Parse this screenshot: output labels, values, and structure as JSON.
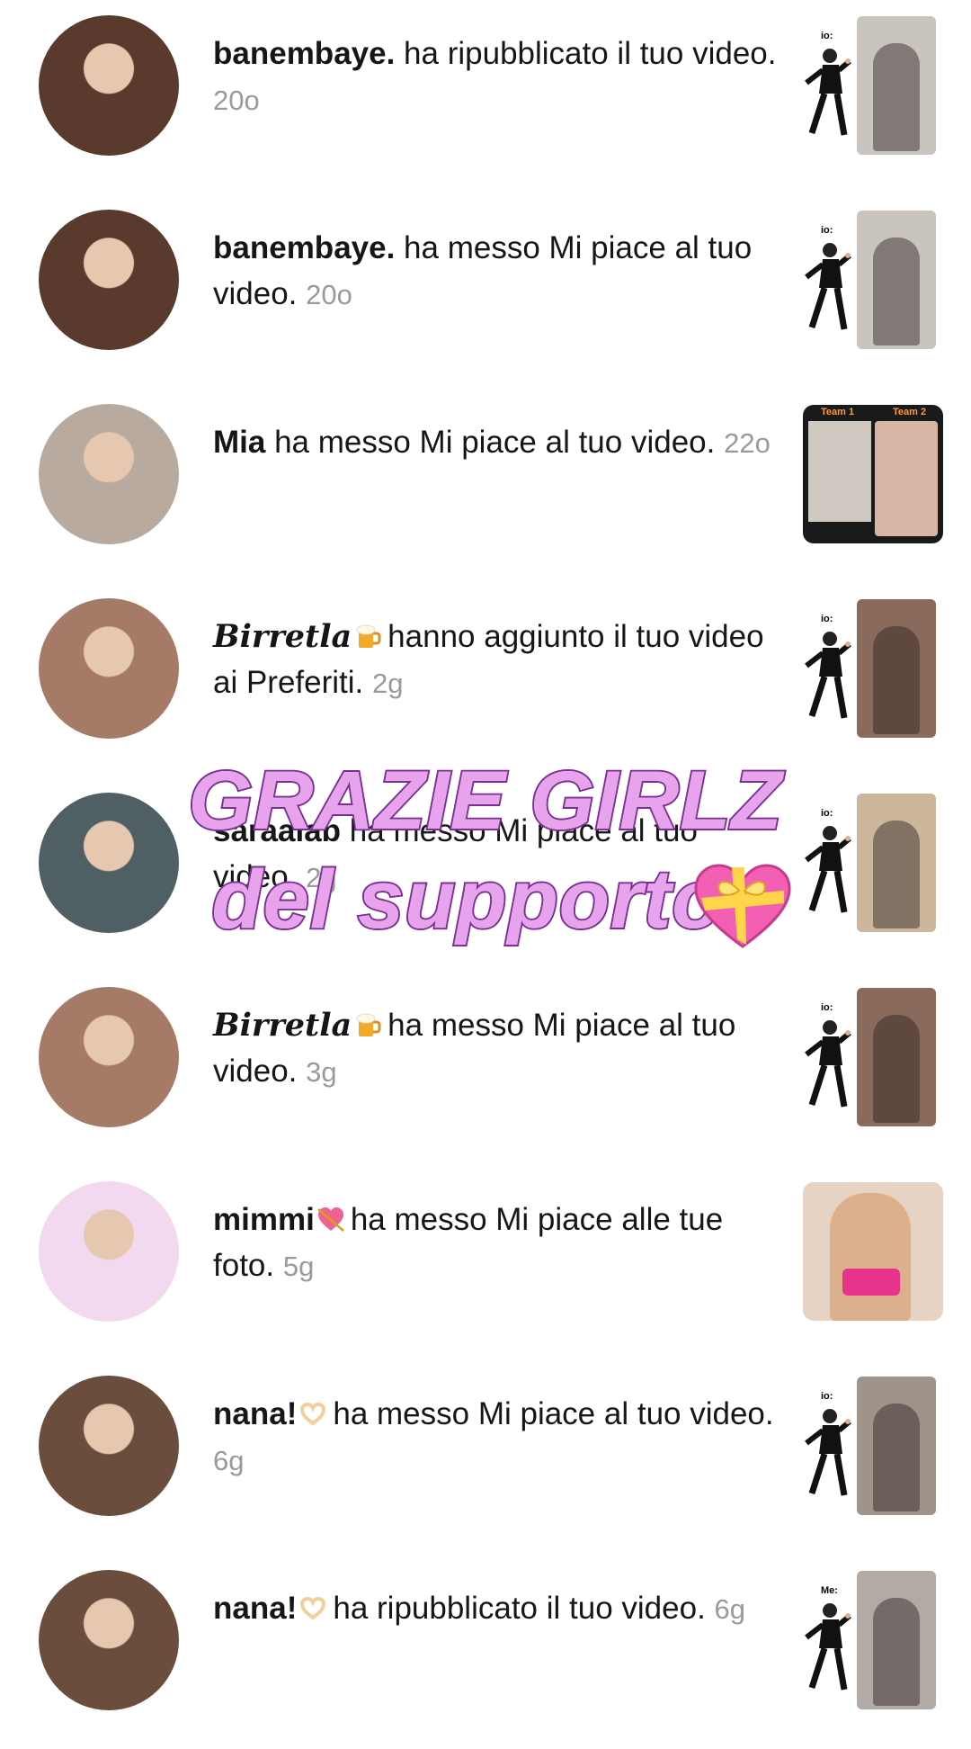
{
  "notifications": [
    {
      "user": "banembaye.",
      "action": "ha ripubblicato il tuo video.",
      "time": "20o",
      "name_style": "bold",
      "thumb": "meme",
      "avatar_color": "#5a3a2c",
      "thumb_color": "#c9c4bd"
    },
    {
      "user": "banembaye.",
      "action": "ha messo Mi piace al tuo video.",
      "time": "20o",
      "name_style": "bold",
      "thumb": "meme",
      "avatar_color": "#5a3a2c",
      "thumb_color": "#c9c4bd"
    },
    {
      "user": "Mia",
      "action": "ha messo Mi piace al tuo video.",
      "time": "22o",
      "name_style": "bold",
      "thumb": "team",
      "avatar_color": "#b9aaa0",
      "thumb_color": "#1a1a1a"
    },
    {
      "user": "Birretla",
      "action": "hanno aggiunto il tuo video ai Preferiti.",
      "time": "2g",
      "name_style": "script",
      "emoji": "beer",
      "thumb": "meme",
      "avatar_color": "#a57a66",
      "thumb_color": "#8a6a5a"
    },
    {
      "user": "saraalab",
      "action": "ha messo Mi piace al tuo video.",
      "time": "2g",
      "name_style": "bold",
      "thumb": "meme",
      "avatar_color": "#4f5f63",
      "thumb_color": "#cdb79c"
    },
    {
      "user": "Birretla",
      "action": "ha messo Mi piace al tuo video.",
      "time": "3g",
      "name_style": "script",
      "emoji": "beer",
      "thumb": "meme",
      "avatar_color": "#a57a66",
      "thumb_color": "#8a6a5a"
    },
    {
      "user": "mimmi",
      "action": "ha messo Mi piace alle tue foto.",
      "time": "5g",
      "name_style": "bold",
      "emoji": "heart-arrow",
      "thumb": "photo",
      "avatar_color": "#f3d9ef",
      "thumb_color": "#e6d3c4"
    },
    {
      "user": "nana!",
      "action": "ha messo Mi piace al tuo video.",
      "time": "6g",
      "name_style": "bold",
      "emoji": "hands-heart",
      "thumb": "meme",
      "avatar_color": "#6b4d3d",
      "thumb_color": "#a0948a"
    },
    {
      "user": "nana!",
      "action": "ha ripubblicato il tuo video.",
      "time": "6g",
      "name_style": "bold",
      "emoji": "hands-heart",
      "thumb": "meme2",
      "avatar_color": "#6b4d3d",
      "thumb_color": "#b2aaa4"
    }
  ],
  "thumb_labels": {
    "io": "io:",
    "me": "Me:",
    "team1": "Team 1",
    "team2": "Team 2"
  },
  "overlay": {
    "line1": "GRAZIE GIRLZ",
    "line2": "del supporto"
  },
  "colors": {
    "overlay_fill": "#e7a4ec",
    "overlay_stroke": "#7b2e93",
    "time": "#9a9a9a",
    "heart": "#f35fb2"
  }
}
